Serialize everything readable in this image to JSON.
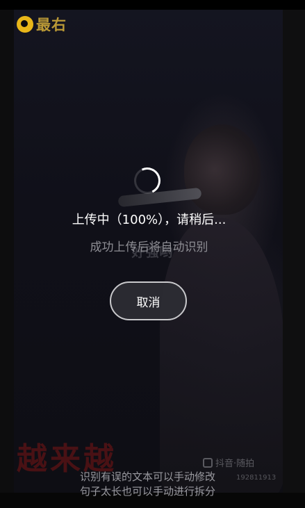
{
  "logo": {
    "text": "最右",
    "color": "#e8b619"
  },
  "video": {
    "burned_subtitle": "好强哟",
    "caption_red": "越来越",
    "watermark_label": "抖音·随拍",
    "watermark_id": "192811913"
  },
  "upload_dialog": {
    "status": "上传中（100%），请稍后...",
    "hint": "成功上传后将自动识别",
    "cancel_label": "取消"
  },
  "tips": {
    "line1": "识别有误的文本可以手动修改",
    "line2": "句子太长也可以手动进行拆分"
  },
  "colors": {
    "accent": "#e8b619",
    "background": "#0b0b0d",
    "text_primary": "#ffffff",
    "text_secondary": "#8e8e94"
  }
}
